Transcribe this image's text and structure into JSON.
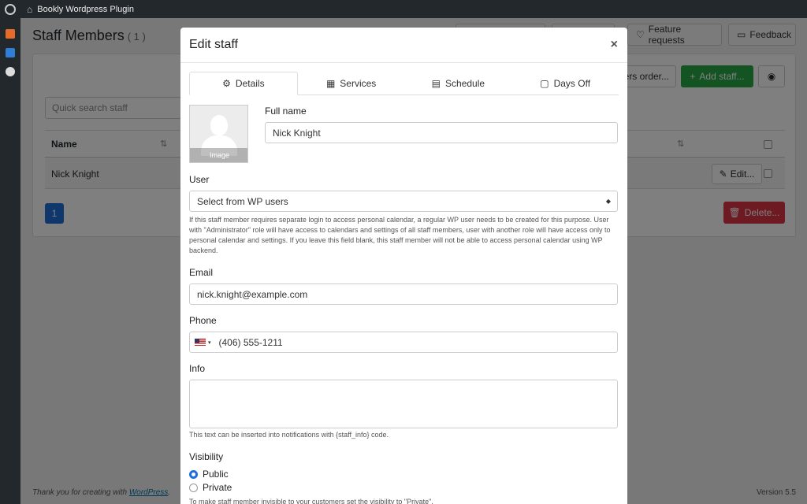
{
  "adminbar": {
    "site_name": "Bookly Wordpress Plugin"
  },
  "page": {
    "title": "Staff Members",
    "count": "( 1 )",
    "feature_requests": "Feature requests",
    "feedback": "Feedback",
    "add_staff": "Add staff...",
    "staff_order": "ers order...",
    "search_placeholder": "Quick search staff",
    "col_name": "Name",
    "row_name": "Nick Knight",
    "edit": "Edit...",
    "page_number": "1",
    "delete": "Delete...",
    "footer_text": "Thank you for creating with ",
    "footer_link": "WordPress",
    "footer_dot": ".",
    "version": "Version 5.5"
  },
  "modal": {
    "title": "Edit staff",
    "close": "×",
    "tabs": [
      {
        "label": "Details",
        "icon": "gear-icon"
      },
      {
        "label": "Services",
        "icon": "grid-icon"
      },
      {
        "label": "Schedule",
        "icon": "calendar-icon"
      },
      {
        "label": "Days Off",
        "icon": "calendar-icon"
      }
    ],
    "image_caption": "Image",
    "full_name_label": "Full name",
    "full_name_value": "Nick Knight",
    "user_label": "User",
    "user_value": "Select from WP users",
    "user_help": "If this staff member requires separate login to access personal calendar, a regular WP user needs to be created for this purpose. User with \"Administrator\" role will have access to calendars and settings of all staff members, user with another role will have access only to personal calendar and settings. If you leave this field blank, this staff member will not be able to access personal calendar using WP backend.",
    "email_label": "Email",
    "email_value": "nick.knight@example.com",
    "phone_label": "Phone",
    "phone_value": "(406) 555-1211",
    "info_label": "Info",
    "info_help": "This text can be inserted into notifications with {staff_info} code.",
    "visibility_label": "Visibility",
    "visibility_public": "Public",
    "visibility_private": "Private",
    "visibility_help": "To make staff member invisible to your customers set the visibility to \"Private\"."
  },
  "colors": {
    "primary": "#1e6fd9",
    "success": "#28a745",
    "danger": "#dc3545",
    "adminbar": "#23282d"
  }
}
